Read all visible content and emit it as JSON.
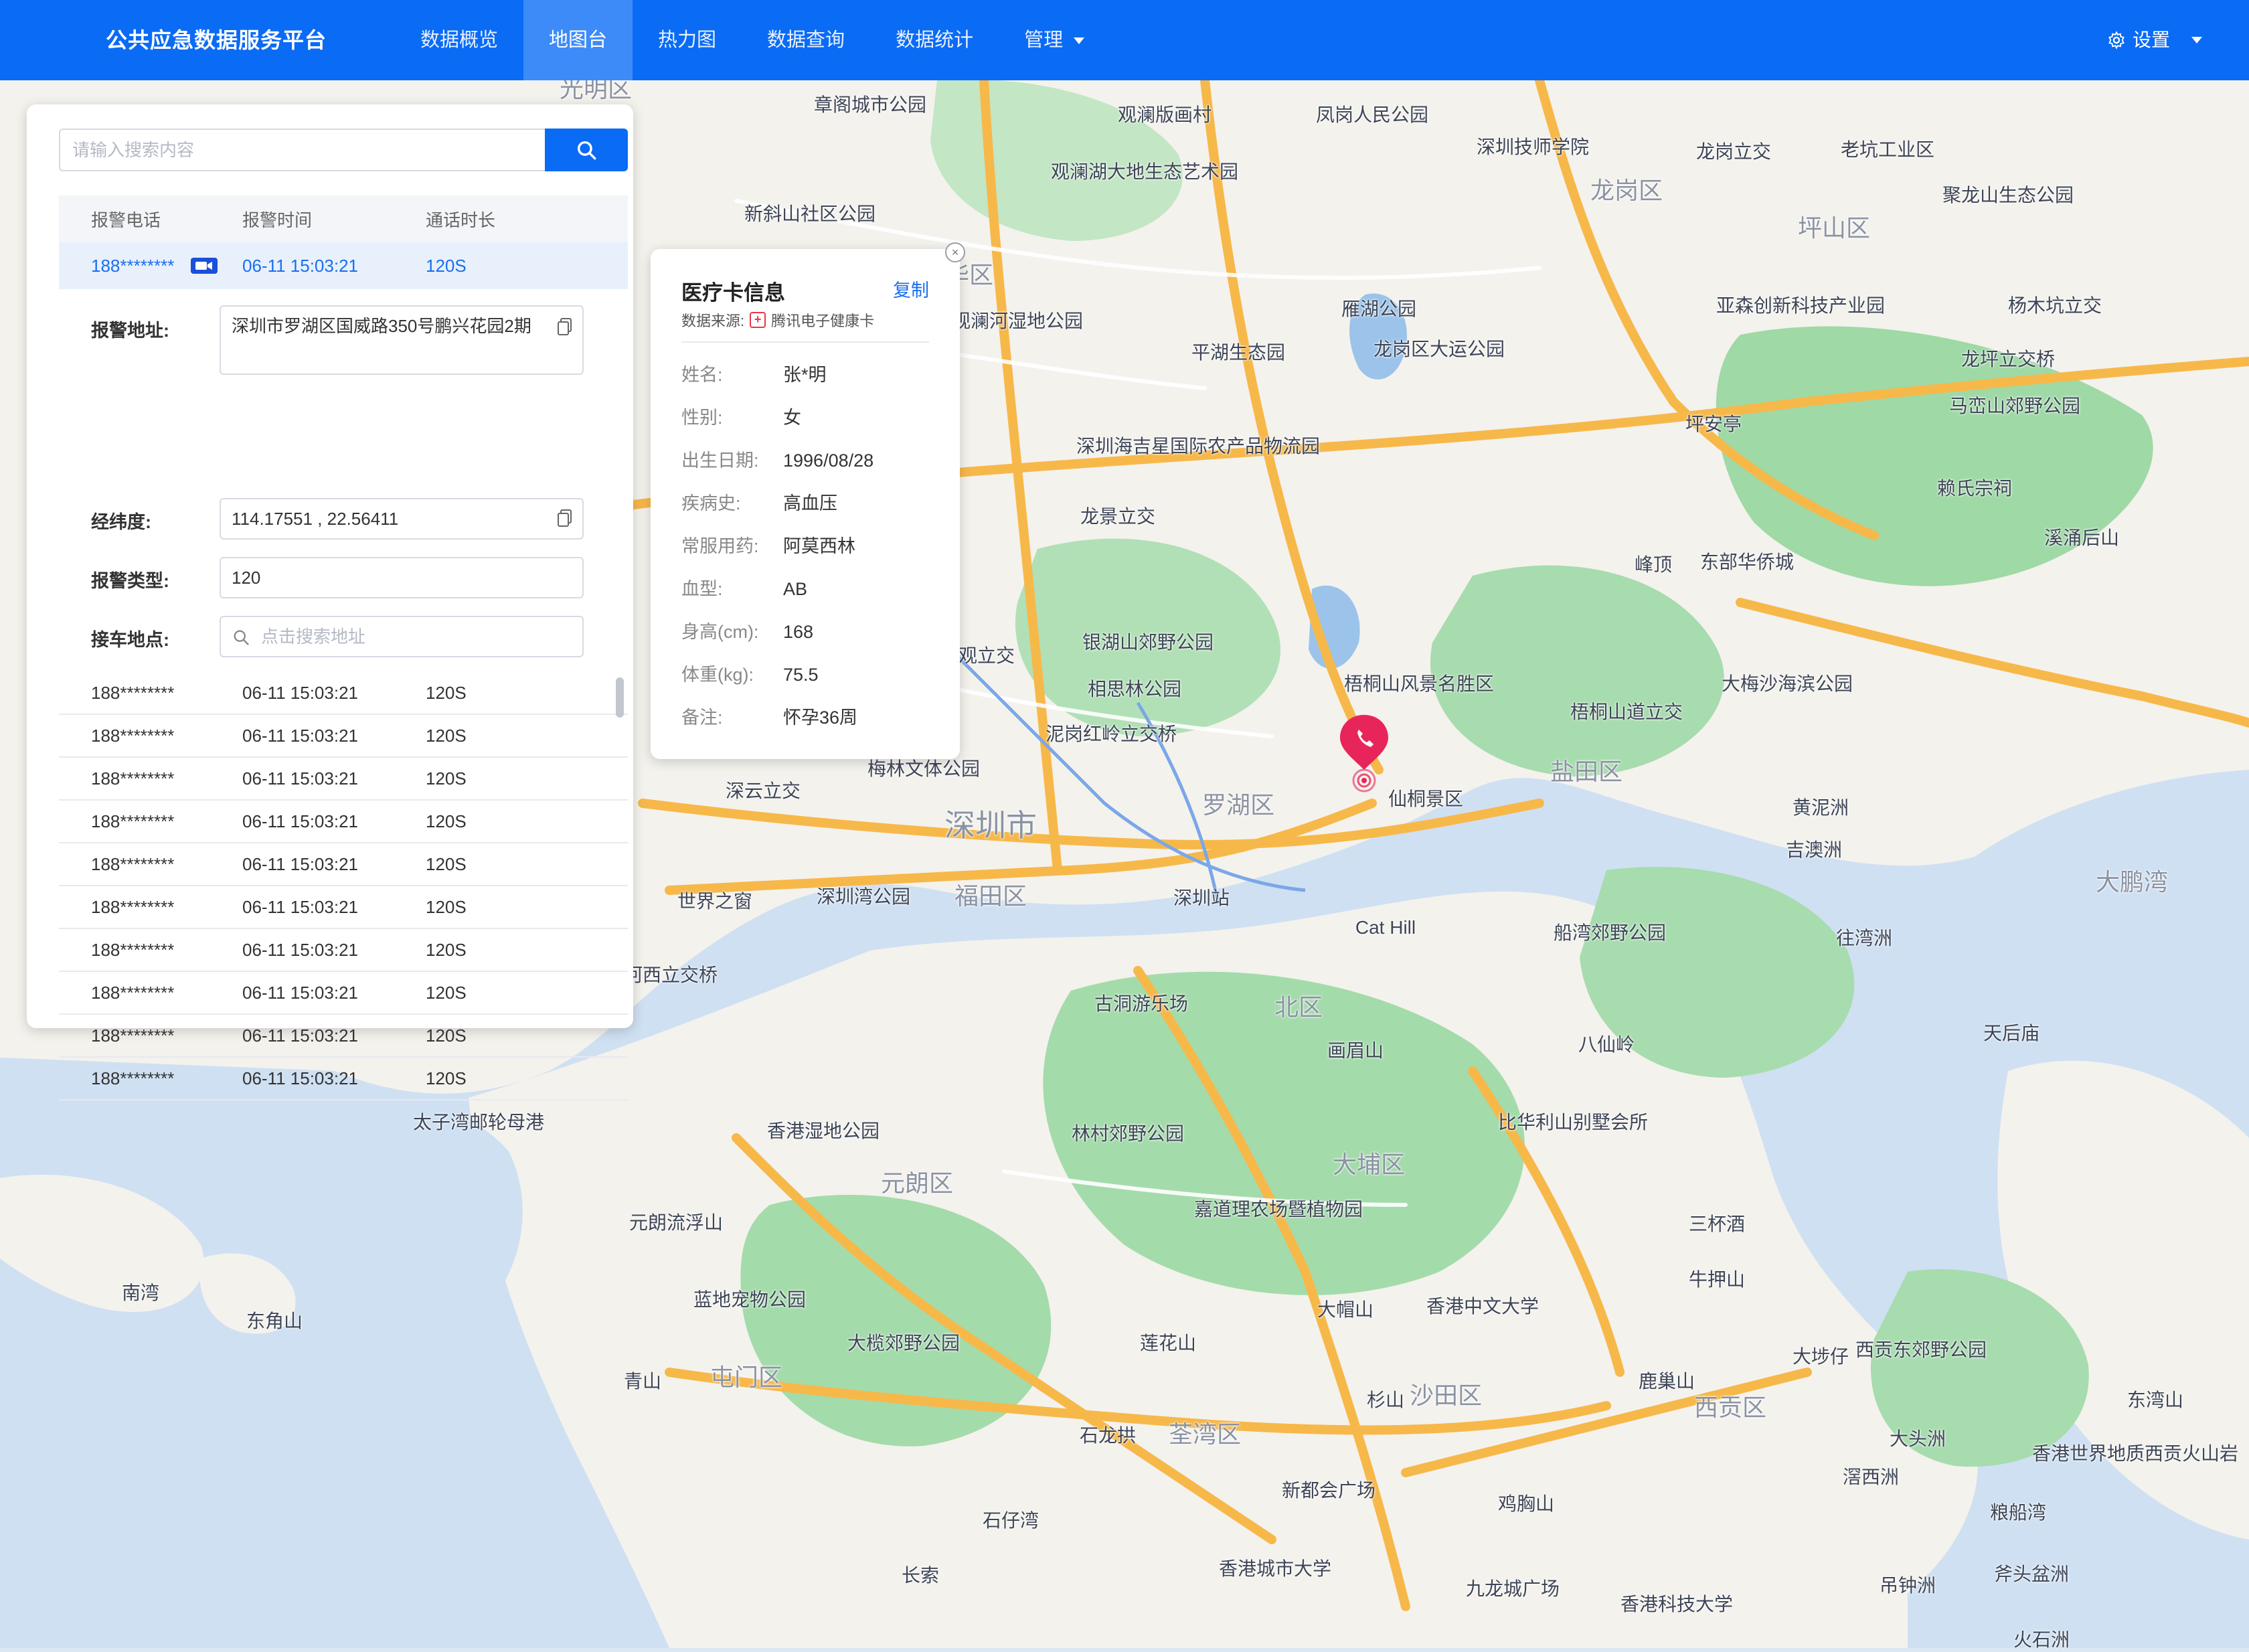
{
  "app": {
    "title": "公共应急数据服务平台"
  },
  "nav": [
    {
      "label": "数据概览",
      "active": false
    },
    {
      "label": "地图台",
      "active": true
    },
    {
      "label": "热力图",
      "active": false
    },
    {
      "label": "数据查询",
      "active": false
    },
    {
      "label": "数据统计",
      "active": false
    },
    {
      "label": "管理",
      "active": false,
      "dropdown": true
    }
  ],
  "settings": {
    "label": "设置"
  },
  "search": {
    "placeholder": "请输入搜索内容",
    "value": ""
  },
  "table": {
    "headers": [
      "报警电话",
      "报警时间",
      "通话时长"
    ],
    "active_row": {
      "phone": "188********",
      "time": "06-11 15:03:21",
      "duration": "120S",
      "icon": "video-icon"
    },
    "rows": [
      {
        "phone": "188********",
        "time": "06-11 15:03:21",
        "duration": "120S"
      },
      {
        "phone": "188********",
        "time": "06-11 15:03:21",
        "duration": "120S"
      },
      {
        "phone": "188********",
        "time": "06-11 15:03:21",
        "duration": "120S"
      },
      {
        "phone": "188********",
        "time": "06-11 15:03:21",
        "duration": "120S"
      },
      {
        "phone": "188********",
        "time": "06-11 15:03:21",
        "duration": "120S"
      },
      {
        "phone": "188********",
        "time": "06-11 15:03:21",
        "duration": "120S"
      },
      {
        "phone": "188********",
        "time": "06-11 15:03:21",
        "duration": "120S"
      },
      {
        "phone": "188********",
        "time": "06-11 15:03:21",
        "duration": "120S"
      },
      {
        "phone": "188********",
        "time": "06-11 15:03:21",
        "duration": "120S"
      },
      {
        "phone": "188********",
        "time": "06-11 15:03:21",
        "duration": "120S"
      }
    ]
  },
  "detail": {
    "address_label": "报警地址:",
    "address_value": "深圳市罗湖区国威路350号鹏兴花园2期",
    "coords_label": "经纬度:",
    "coords_value": "114.17551 , 22.56411",
    "type_label": "报警类型:",
    "type_value": "120",
    "pickup_label": "接车地点:",
    "pickup_placeholder": "点击搜索地址"
  },
  "medical_card": {
    "title": "医疗卡信息",
    "copy_label": "复制",
    "source_label": "数据来源:",
    "source_value": "腾讯电子健康卡",
    "fields": [
      {
        "key": "姓名:",
        "value": "张*明"
      },
      {
        "key": "性别:",
        "value": "女"
      },
      {
        "key": "出生日期:",
        "value": "1996/08/28"
      },
      {
        "key": "疾病史:",
        "value": "高血压"
      },
      {
        "key": "常服用药:",
        "value": "阿莫西林"
      },
      {
        "key": "血型:",
        "value": "AB"
      },
      {
        "key": "身高(cm):",
        "value": "168"
      },
      {
        "key": "体重(kg):",
        "value": "75.5"
      },
      {
        "key": "备注:",
        "value": "怀孕36周"
      }
    ]
  },
  "map_labels": [
    "光明区",
    "章阁城市公园",
    "观澜版画村",
    "凤岗人民公园",
    "深圳技师学院",
    "龙岗立交",
    "老坑工业区",
    "观澜湖大地生态艺术园",
    "新斜山社区公园",
    "龙华区",
    "龙岗区",
    "坪山区",
    "聚龙山生态公园",
    "观澜河湿地公园",
    "平湖生态园",
    "雁湖公园",
    "龙岗区大运公园",
    "亚森创新科技产业园",
    "杨木坑立交",
    "龙坪立交桥",
    "马峦山郊野公园",
    "坪安亭",
    "深圳海吉星国际农产品物流园",
    "龙景立交",
    "赖氏宗祠",
    "峰顶",
    "东部华侨城",
    "溪涌后山",
    "梅观立交",
    "银湖山郊野公园",
    "相思林公园",
    "梧桐山风景名胜区",
    "梧桐山道立交",
    "大梅沙海滨公园",
    "泥岗红岭立交桥",
    "仙桐景区",
    "盐田区",
    "深云立交",
    "梅林文体公园",
    "深圳市",
    "罗湖区",
    "黄泥洲",
    "吉澳洲",
    "世界之窗",
    "深圳湾公园",
    "福田区",
    "深圳站",
    "大鹏湾",
    "Cat Hill",
    "船湾郊野公园",
    "往湾洲",
    "东滨沙河西立交桥",
    "古洞游乐场",
    "北区",
    "天后庙",
    "八仙岭",
    "画眉山",
    "太子湾邮轮母港",
    "香港湿地公园",
    "林村郊野公园",
    "比华利山别墅会所",
    "元朗区",
    "大埔区",
    "元朗流浮山",
    "嘉道理农场暨植物园",
    "三杯酒",
    "牛押山",
    "南湾",
    "东角山",
    "蓝地宠物公园",
    "香港中文大学",
    "大帽山",
    "西贡东郊野公园",
    "大榄郊野公园",
    "莲花山",
    "大埗仔",
    "鹿巢山",
    "青山",
    "屯门区",
    "杉山",
    "沙田区",
    "西贡区",
    "东湾山",
    "石龙拱",
    "荃湾区",
    "大头洲",
    "香港世界地质西贡火山岩",
    "滘西洲",
    "新都会广场",
    "鸡胸山",
    "石仔湾",
    "粮船湾",
    "长索",
    "香港城市大学",
    "九龙城广场",
    "香港科技大学",
    "吊钟洲",
    "斧头盆洲",
    "火石洲"
  ],
  "colors": {
    "primary": "#0a6bf5",
    "nav_active": "#3d8bf8",
    "link": "#1a6ef0",
    "pin": "#e8255a"
  }
}
